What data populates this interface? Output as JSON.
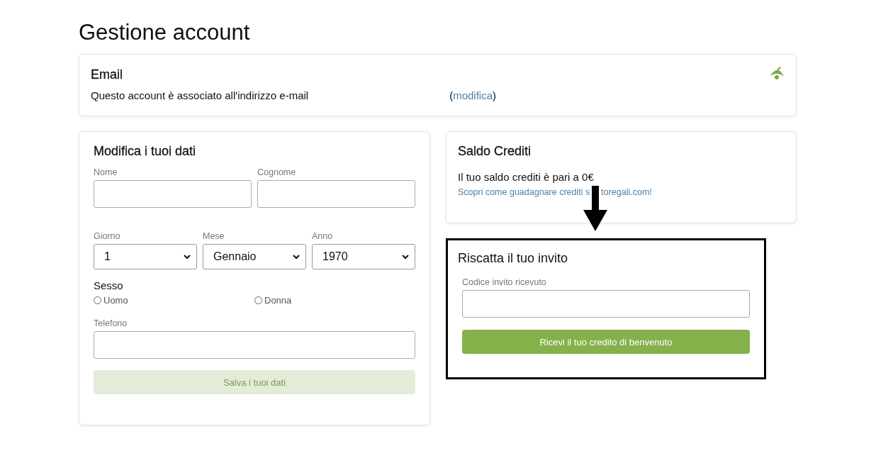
{
  "page": {
    "title": "Gestione account"
  },
  "email_card": {
    "title": "Email",
    "text": "Questo account è associato all'indirizzo e-mail",
    "edit_open": "(",
    "edit_link": "modifica",
    "edit_close": ")"
  },
  "profile_form": {
    "title": "Modifica i tuoi dati",
    "name_fields": [
      {
        "label": "Nome"
      },
      {
        "label": "Cognome"
      }
    ],
    "date_fields": [
      {
        "label": "Giorno",
        "value": "1"
      },
      {
        "label": "Mese",
        "value": "Gennaio"
      },
      {
        "label": "Anno",
        "value": "1970"
      }
    ],
    "gender": {
      "label": "Sesso",
      "options": [
        {
          "label": "Uomo",
          "selected": false
        },
        {
          "label": "Donna",
          "selected": false
        }
      ]
    },
    "phone": {
      "label": "Telefono"
    },
    "save_button": {
      "label": "Salva i tuoi dati",
      "disabled": true
    }
  },
  "credits_card": {
    "title": "Saldo Crediti",
    "balance": "Il tuo saldo crediti è pari a 0€",
    "link_start": "Scopri come guadagnare crediti s",
    "link_end": "toregali.com!"
  },
  "invite_card": {
    "title": "Riscatta il tuo invito",
    "code_label": "Codice invito ricevuto",
    "submit_button": {
      "label": "Ricevi il tuo credito di benvenuto"
    }
  }
}
